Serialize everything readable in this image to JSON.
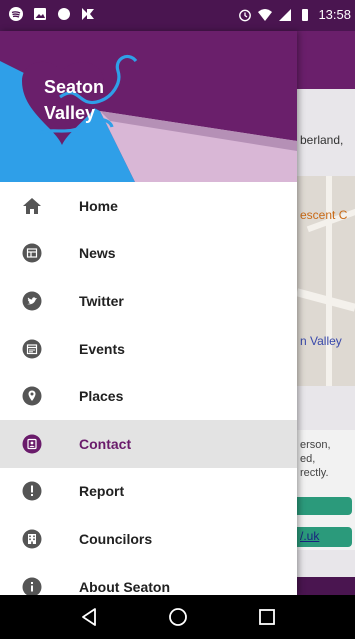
{
  "status_bar": {
    "time": "13:58",
    "icons": [
      "spotify-icon",
      "image-icon",
      "circle-icon",
      "notification-icon",
      "alarm-icon",
      "wifi-icon",
      "signal-icon",
      "battery-icon"
    ]
  },
  "header": {
    "logo_line1": "Seaton",
    "logo_line2": "Valley",
    "colors": {
      "purple": "#6a1f6b",
      "blue": "#2f9fe8",
      "pink": "#d9b7d6"
    }
  },
  "nav": {
    "items": [
      {
        "label": "Home",
        "icon": "home-icon"
      },
      {
        "label": "News",
        "icon": "news-icon"
      },
      {
        "label": "Twitter",
        "icon": "twitter-icon"
      },
      {
        "label": "Events",
        "icon": "events-icon"
      },
      {
        "label": "Places",
        "icon": "places-icon"
      },
      {
        "label": "Contact",
        "icon": "contact-icon",
        "selected": true
      },
      {
        "label": "Report",
        "icon": "report-icon"
      },
      {
        "label": "Councilors",
        "icon": "councilors-icon"
      },
      {
        "label": "About Seaton",
        "icon": "info-icon"
      }
    ],
    "selected_color": "#6a1b6b"
  },
  "background": {
    "line1": "berland,",
    "map_label1": "escent C",
    "map_label2": "n Valley",
    "para": "erson,\ned,\nrectly.",
    "link": "/.uk"
  },
  "system_nav": {
    "buttons": [
      "back-icon",
      "home-circle-icon",
      "recents-icon"
    ]
  }
}
